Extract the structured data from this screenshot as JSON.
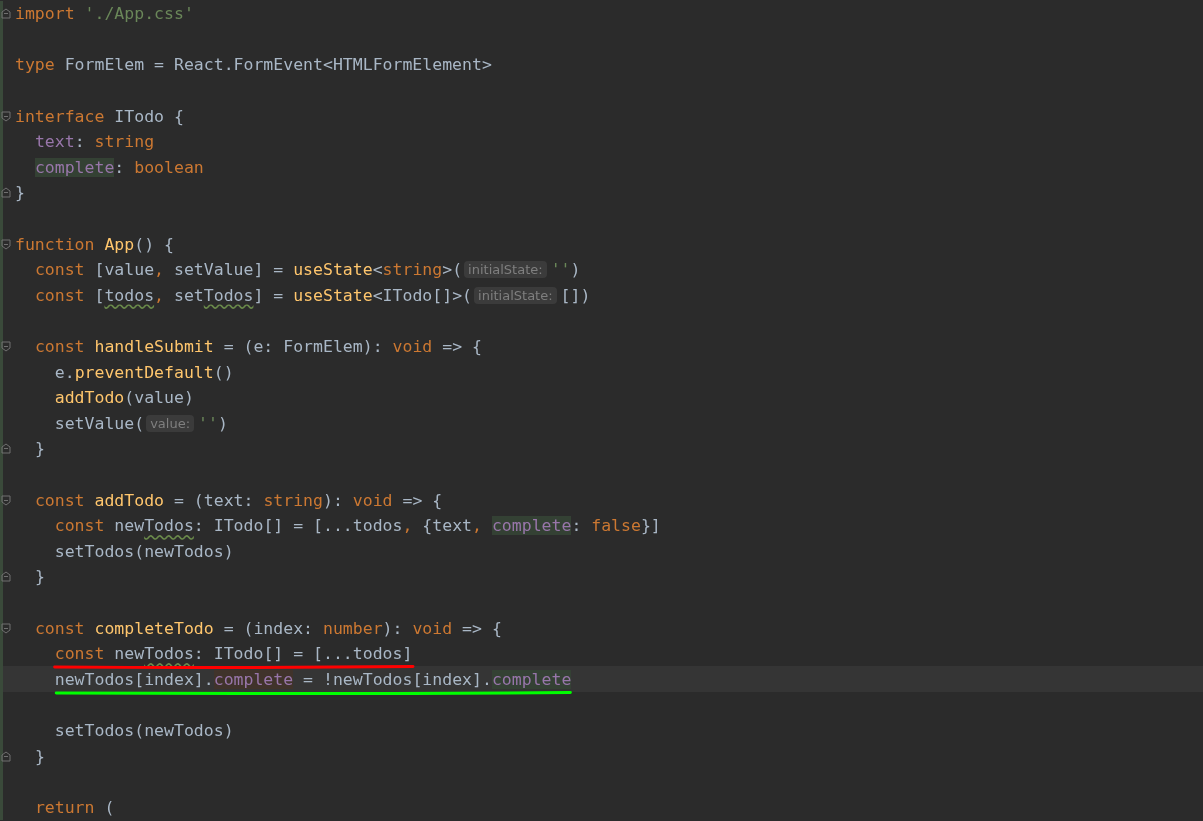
{
  "editor": {
    "lines": [
      {
        "kind": "block-end",
        "tokens": [
          {
            "text": "import",
            "kind": "keyword"
          },
          {
            "text": " './App.css'",
            "kind": "string"
          }
        ]
      },
      {
        "kind": "line"
      },
      {
        "kind": "line",
        "tokens": [
          {
            "text": "type",
            "kind": "keyword"
          },
          {
            "text": " FormElem = React.FormEvent<HTMLFormElement>",
            "kind": "plain"
          }
        ]
      },
      {
        "kind": "line"
      },
      {
        "kind": "block-start",
        "tokens": [
          {
            "text": "interface",
            "kind": "keyword"
          },
          {
            "text": " ITodo {",
            "kind": "plain"
          }
        ]
      },
      {
        "kind": "line",
        "tokens": [
          {
            "text": "  text",
            "kind": "property",
            "highlighted": false
          },
          {
            "text": ": ",
            "kind": "plain"
          },
          {
            "text": "string",
            "kind": "keyword"
          }
        ]
      },
      {
        "kind": "line",
        "tokens": [
          {
            "text": "  complete",
            "kind": "property",
            "highlighted": true,
            "write": false
          },
          {
            "text": ": ",
            "kind": "plain"
          },
          {
            "text": "boolean",
            "kind": "keyword"
          }
        ]
      },
      {
        "kind": "block-end",
        "tokens": [
          {
            "text": "}",
            "kind": "plain"
          }
        ]
      },
      {
        "kind": "line"
      },
      {
        "kind": "block-start",
        "tokens": [
          {
            "text": "function ",
            "kind": "keyword"
          },
          {
            "text": "App",
            "kind": "function"
          },
          {
            "text": "() {",
            "kind": "plain"
          }
        ]
      },
      {
        "kind": "line",
        "tokens": [
          {
            "text": "  const",
            "kind": "keyword"
          },
          {
            "text": " [value",
            "kind": "plain"
          },
          {
            "text": ",",
            "kind": "keyword"
          },
          {
            "text": " setValue] = ",
            "kind": "plain"
          },
          {
            "text": "useState",
            "kind": "function"
          },
          {
            "text": "<",
            "kind": "plain"
          },
          {
            "text": "string",
            "kind": "keyword"
          },
          {
            "text": ">(",
            "kind": "plain"
          },
          {
            "text": "initialState:",
            "kind": "hint"
          },
          {
            "text": "''",
            "kind": "string"
          },
          {
            "text": ")",
            "kind": "plain"
          }
        ]
      },
      {
        "kind": "line",
        "tokens": [
          {
            "text": "  const",
            "kind": "keyword"
          },
          {
            "text": " [",
            "kind": "plain"
          },
          {
            "text": "todos",
            "kind": "plain",
            "typo": true
          },
          {
            "text": ",",
            "kind": "keyword"
          },
          {
            "text": " set",
            "kind": "plain"
          },
          {
            "text": "Todos",
            "kind": "plain",
            "typo": true
          },
          {
            "text": "] = ",
            "kind": "plain"
          },
          {
            "text": "useState",
            "kind": "function"
          },
          {
            "text": "<ITodo[]>(",
            "kind": "plain"
          },
          {
            "text": "initialState:",
            "kind": "hint"
          },
          {
            "text": "[])",
            "kind": "plain"
          }
        ]
      },
      {
        "kind": "line"
      },
      {
        "kind": "block-start",
        "tokens": [
          {
            "text": "  const ",
            "kind": "keyword"
          },
          {
            "text": "handleSubmit",
            "kind": "function"
          },
          {
            "text": " = (e: FormElem): ",
            "kind": "plain"
          },
          {
            "text": "void",
            "kind": "keyword"
          },
          {
            "text": " => {",
            "kind": "plain"
          }
        ]
      },
      {
        "kind": "line",
        "tokens": [
          {
            "text": "    e.",
            "kind": "plain"
          },
          {
            "text": "preventDefault",
            "kind": "function"
          },
          {
            "text": "()",
            "kind": "plain"
          }
        ]
      },
      {
        "kind": "line",
        "tokens": [
          {
            "text": "    addTodo",
            "kind": "function"
          },
          {
            "text": "(value)",
            "kind": "plain"
          }
        ]
      },
      {
        "kind": "line",
        "tokens": [
          {
            "text": "    setValue(",
            "kind": "plain"
          },
          {
            "text": "value:",
            "kind": "hint"
          },
          {
            "text": "''",
            "kind": "string"
          },
          {
            "text": ")",
            "kind": "plain"
          }
        ]
      },
      {
        "kind": "block-end",
        "tokens": [
          {
            "text": "  }",
            "kind": "plain"
          }
        ]
      },
      {
        "kind": "line"
      },
      {
        "kind": "block-start",
        "tokens": [
          {
            "text": "  const ",
            "kind": "keyword"
          },
          {
            "text": "addTodo",
            "kind": "function"
          },
          {
            "text": " = (text: ",
            "kind": "plain"
          },
          {
            "text": "string",
            "kind": "keyword"
          },
          {
            "text": "): ",
            "kind": "plain"
          },
          {
            "text": "void",
            "kind": "keyword"
          },
          {
            "text": " => {",
            "kind": "plain"
          }
        ]
      },
      {
        "kind": "line",
        "tokens": [
          {
            "text": "    const",
            "kind": "keyword"
          },
          {
            "text": " new",
            "kind": "plain"
          },
          {
            "text": "Todos",
            "kind": "plain",
            "typo": true
          },
          {
            "text": ": ITodo[] = [...todos",
            "kind": "plain"
          },
          {
            "text": ",",
            "kind": "keyword"
          },
          {
            "text": " {text",
            "kind": "plain"
          },
          {
            "text": ", ",
            "kind": "keyword"
          },
          {
            "text": "complete",
            "kind": "property",
            "highlighted": true,
            "write": false
          },
          {
            "text": ": ",
            "kind": "plain"
          },
          {
            "text": "false",
            "kind": "keyword"
          },
          {
            "text": "}]",
            "kind": "plain"
          }
        ]
      },
      {
        "kind": "line",
        "tokens": [
          {
            "text": "    setTodos(newTodos)",
            "kind": "plain"
          }
        ]
      },
      {
        "kind": "block-end",
        "tokens": [
          {
            "text": "  }",
            "kind": "plain"
          }
        ]
      },
      {
        "kind": "line"
      },
      {
        "kind": "block-start",
        "tokens": [
          {
            "text": "  const ",
            "kind": "keyword"
          },
          {
            "text": "completeTodo",
            "kind": "function"
          },
          {
            "text": " = (index: ",
            "kind": "plain"
          },
          {
            "text": "number",
            "kind": "keyword"
          },
          {
            "text": "): ",
            "kind": "plain"
          },
          {
            "text": "void",
            "kind": "keyword"
          },
          {
            "text": " => {",
            "kind": "plain"
          }
        ]
      },
      {
        "kind": "line",
        "underline": {
          "color": "#ff0000"
        },
        "tokens": [
          {
            "text": "    const",
            "kind": "keyword"
          },
          {
            "text": " new",
            "kind": "plain"
          },
          {
            "text": "Todos",
            "kind": "plain",
            "typo": true
          },
          {
            "text": ": ITodo[] = [...todos]",
            "kind": "plain"
          }
        ]
      },
      {
        "kind": "line",
        "current": true,
        "underline": {
          "color": "#00ff00"
        },
        "tokens": [
          {
            "text": "    newTodos[index].",
            "kind": "plain"
          },
          {
            "text": "complete",
            "kind": "property",
            "highlighted": true,
            "write": true
          },
          {
            "text": " = !newTodos[index].",
            "kind": "plain"
          },
          {
            "text": "complete",
            "kind": "property",
            "highlighted": true,
            "write": false
          }
        ]
      },
      {
        "kind": "line"
      },
      {
        "kind": "line",
        "tokens": [
          {
            "text": "    setTodos(newTodos)",
            "kind": "plain"
          }
        ]
      },
      {
        "kind": "block-end",
        "tokens": [
          {
            "text": "  }",
            "kind": "plain"
          }
        ]
      },
      {
        "kind": "line"
      },
      {
        "kind": "line",
        "tokens": [
          {
            "text": "  return",
            "kind": "keyword"
          },
          {
            "text": " (",
            "kind": "plain"
          }
        ]
      }
    ]
  }
}
